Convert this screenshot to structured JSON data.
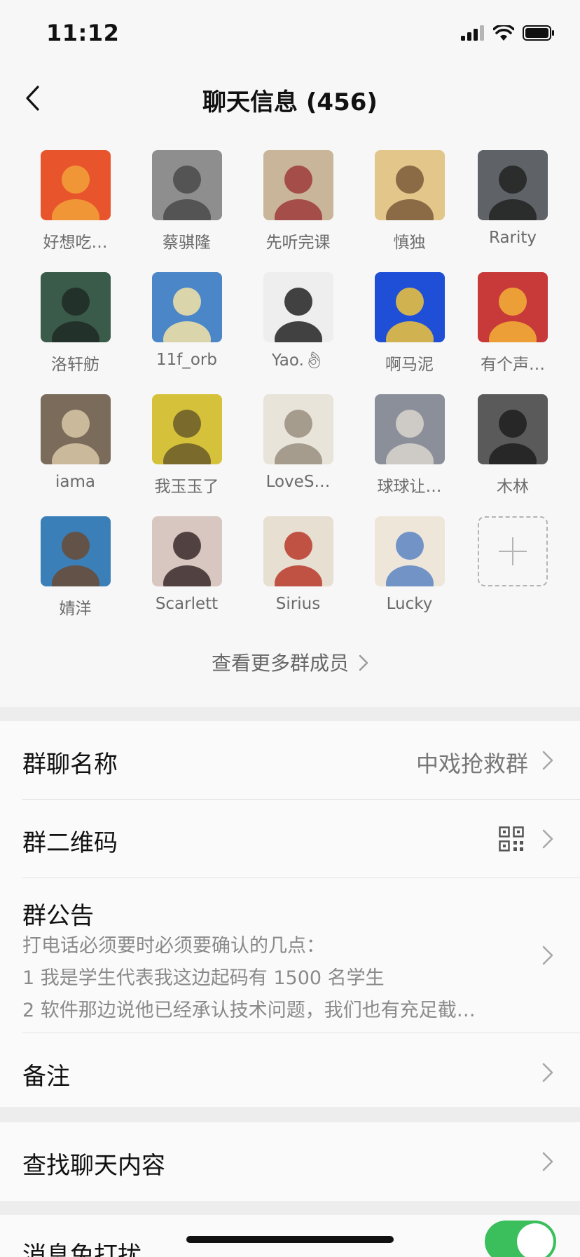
{
  "status_bar": {
    "time": "11:12"
  },
  "nav": {
    "title": "聊天信息 (456)"
  },
  "members": [
    {
      "name": "好想吃…",
      "icon": "tiger-avatar-icon"
    },
    {
      "name": "蔡骐隆",
      "icon": "person-photo-icon"
    },
    {
      "name": "先听完课",
      "icon": "comic-avatar-icon"
    },
    {
      "name": "慎独",
      "icon": "ancient-painting-icon"
    },
    {
      "name": "Rarity",
      "icon": "dog-photo-icon"
    },
    {
      "name": "洛轩舫",
      "icon": "blurred-person-icon"
    },
    {
      "name": "11f_orb",
      "icon": "anime-girl-icon"
    },
    {
      "name": "Yao.👌︎",
      "icon": "girl-photo-icon"
    },
    {
      "name": "啊马泥",
      "icon": "cartoon-robot-icon"
    },
    {
      "name": "有个声…",
      "icon": "poster-avatar-icon"
    },
    {
      "name": "iama",
      "icon": "dog-sunglasses-icon"
    },
    {
      "name": "我玉玉了",
      "icon": "dancer-circle-icon"
    },
    {
      "name": "LoveS…",
      "icon": "white-dog-icon"
    },
    {
      "name": "球球让…",
      "icon": "bird-crowd-icon"
    },
    {
      "name": "木林",
      "icon": "man-portrait-icon"
    },
    {
      "name": "婧洋",
      "icon": "dog-goggles-icon"
    },
    {
      "name": "Scarlett",
      "icon": "woman-portrait-icon"
    },
    {
      "name": "Sirius",
      "icon": "cat-box-icon"
    },
    {
      "name": "Lucky",
      "icon": "girl-illustration-icon"
    }
  ],
  "more_members": "查看更多群成员",
  "settings": {
    "group_name_label": "群聊名称",
    "group_name_value": "中戏抢救群",
    "qr_label": "群二维码",
    "notice_label": "群公告",
    "notice_lines": [
      "打电话必须要时必须要确认的几点：",
      "1 我是学生代表我这边起码有 1500 名学生",
      "2 软件那边说他已经承认技术问题，我们也有充足截…"
    ],
    "remark_label": "备注",
    "search_label": "查找聊天内容",
    "mute_label": "消息免打扰",
    "mute_on": true
  },
  "colors": {
    "toggle_on": "#3bbf5c",
    "background": "#ededed"
  }
}
